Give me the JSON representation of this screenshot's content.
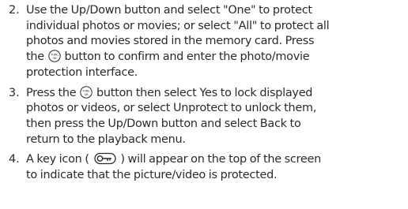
{
  "instructions": {
    "steps": [
      {
        "number": "2.",
        "lines": [
          [
            "Use the Up/Down button and select \"One\" to protect"
          ],
          [
            "individual photos or movies; or select \"All\" to protect all"
          ],
          [
            "photos and movies stored in the memory card. Press"
          ],
          [
            "the ",
            " button to confirm and enter the photo/movie"
          ],
          [
            "protection interface."
          ]
        ]
      },
      {
        "number": "3.",
        "lines": [
          [
            "Press the ",
            " button then select Yes to lock displayed"
          ],
          [
            "photos or videos, or select Unprotect to unlock them,"
          ],
          [
            "then press the Up/Down button and select Back to"
          ],
          [
            "return to the playback menu."
          ]
        ]
      },
      {
        "number": "4.",
        "lines": [
          [
            "A key icon ( ",
            " ) will appear on the top of the screen"
          ],
          [
            "to indicate that the picture/video is protected."
          ]
        ]
      }
    ],
    "icons": {
      "func_button": "func-ok-button-icon",
      "key": "key-icon"
    },
    "func_icon_labels": {
      "top": "FUNC",
      "bottom": "OK"
    }
  }
}
